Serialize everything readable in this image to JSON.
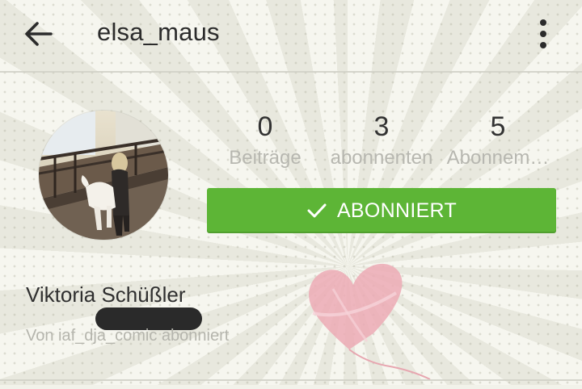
{
  "header": {
    "username": "elsa_maus",
    "back_icon": "arrow-left-icon",
    "menu_icon": "more-vertical-icon"
  },
  "profile": {
    "avatar": "profile-photo",
    "stats": [
      {
        "value": "0",
        "label": "Beiträge"
      },
      {
        "value": "3",
        "label": "abonnenten"
      },
      {
        "value": "5",
        "label": "Abonnem…"
      }
    ],
    "follow_button": {
      "label": "ABONNIERT",
      "icon": "checkmark-icon",
      "color": "#5db536"
    },
    "full_name": "Viktoria Schüßler",
    "followed_by": "Von iaf_dja_comic abonniert"
  }
}
